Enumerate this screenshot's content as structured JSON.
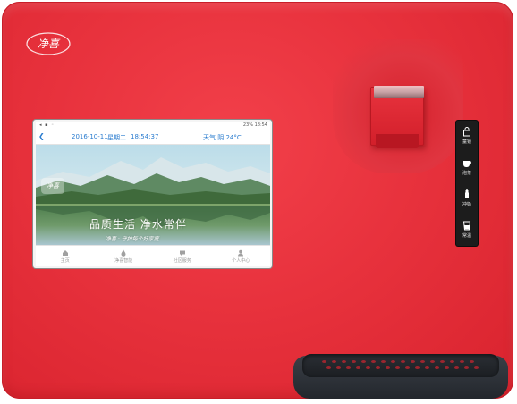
{
  "device": {
    "brand_logo_text": "净喜",
    "accent_color": "#e8323d"
  },
  "screen": {
    "status_bar": {
      "right_text": "23% 18:54"
    },
    "title_bar": {
      "back_icon": "back-arrow-icon",
      "date": "2016-10-11",
      "weekday": "星期二",
      "time": "18:54:37",
      "weather": "天气  阴  24°C"
    },
    "banner": {
      "logo_text": "净喜",
      "slogan": "品质生活   净水常伴",
      "subtitle": "净喜 · 守护每个好家庭"
    },
    "bottom_nav": [
      {
        "label": "主页",
        "icon": "home-icon"
      },
      {
        "label": "净喜智能",
        "icon": "water-drop-icon"
      },
      {
        "label": "社区服务",
        "icon": "chat-icon"
      },
      {
        "label": "个人中心",
        "icon": "person-icon"
      }
    ]
  },
  "touch_panel": {
    "buttons": [
      {
        "label": "童锁",
        "icon": "lock-icon"
      },
      {
        "label": "泡茶",
        "icon": "tea-cup-icon"
      },
      {
        "label": "冲奶",
        "icon": "baby-bottle-icon"
      },
      {
        "label": "常温",
        "icon": "water-glass-icon"
      }
    ]
  }
}
